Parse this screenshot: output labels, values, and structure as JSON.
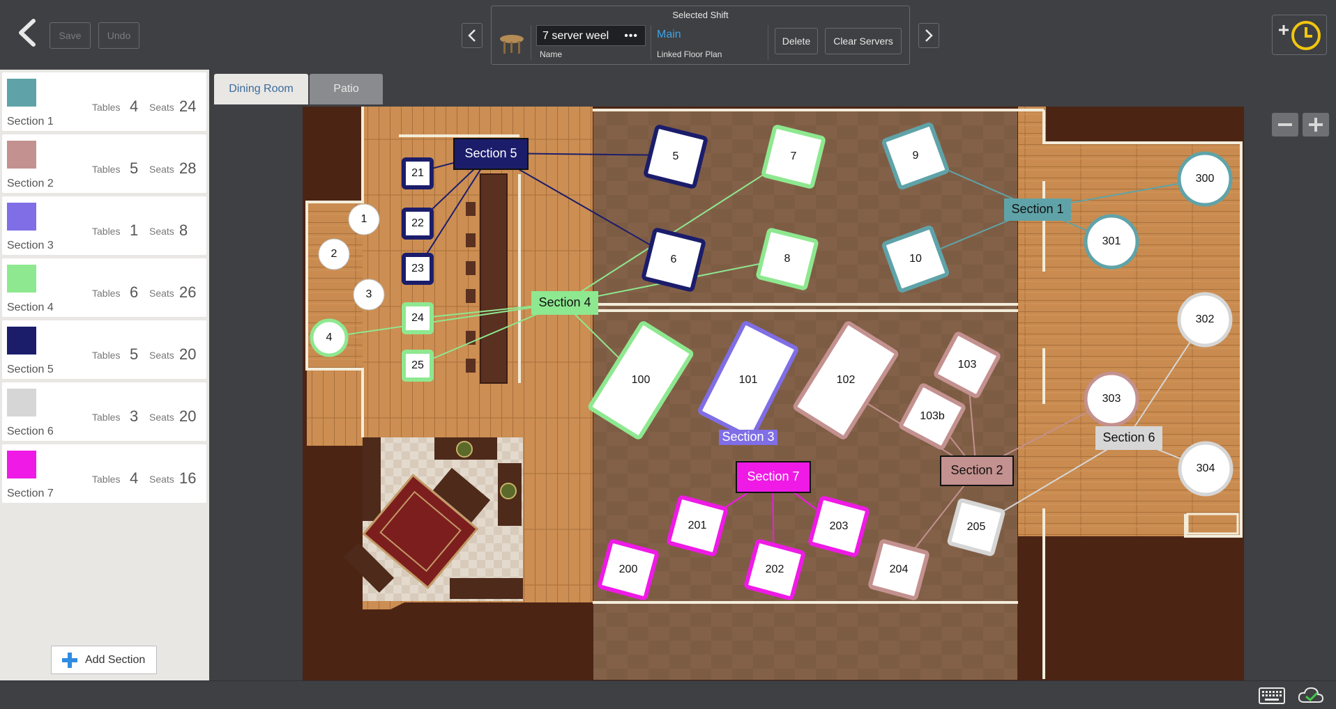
{
  "toolbar": {
    "save_label": "Save",
    "undo_label": "Undo"
  },
  "shift": {
    "title": "Selected Shift",
    "name_value": "7 server weel",
    "more_glyph": "•••",
    "name_caption": "Name",
    "linked_plan": "Main",
    "linked_caption": "Linked Floor Plan",
    "delete_label": "Delete",
    "clear_label": "Clear Servers"
  },
  "sections": [
    {
      "name": "Section 1",
      "color": "#5fa3a8",
      "tables_label": "Tables",
      "tables": "4",
      "seats_label": "Seats",
      "seats": "24"
    },
    {
      "name": "Section 2",
      "color": "#c3918f",
      "tables_label": "Tables",
      "tables": "5",
      "seats_label": "Seats",
      "seats": "28"
    },
    {
      "name": "Section 3",
      "color": "#7f6ee6",
      "tables_label": "Tables",
      "tables": "1",
      "seats_label": "Seats",
      "seats": "8"
    },
    {
      "name": "Section 4",
      "color": "#8ee890",
      "tables_label": "Tables",
      "tables": "6",
      "seats_label": "Seats",
      "seats": "26"
    },
    {
      "name": "Section 5",
      "color": "#1b1d6b",
      "tables_label": "Tables",
      "tables": "5",
      "seats_label": "Seats",
      "seats": "20"
    },
    {
      "name": "Section 6",
      "color": "#d6d6d6",
      "tables_label": "Tables",
      "tables": "3",
      "seats_label": "Seats",
      "seats": "20"
    },
    {
      "name": "Section 7",
      "color": "#ef1ae6",
      "tables_label": "Tables",
      "tables": "4",
      "seats_label": "Seats",
      "seats": "16"
    }
  ],
  "add_section_label": "Add Section",
  "tabs": [
    {
      "label": "Dining Room",
      "active": true
    },
    {
      "label": "Patio",
      "active": false
    }
  ],
  "floor": {
    "section_labels": [
      "Section 1",
      "Section 2",
      "Section 3",
      "Section 4",
      "Section 5",
      "Section 6",
      "Section 7"
    ],
    "tables": [
      "1",
      "2",
      "3",
      "4",
      "5",
      "6",
      "7",
      "8",
      "9",
      "10",
      "21",
      "22",
      "23",
      "24",
      "25",
      "100",
      "101",
      "102",
      "103",
      "103b",
      "200",
      "201",
      "202",
      "203",
      "204",
      "205",
      "300",
      "301",
      "302",
      "303",
      "304"
    ]
  }
}
